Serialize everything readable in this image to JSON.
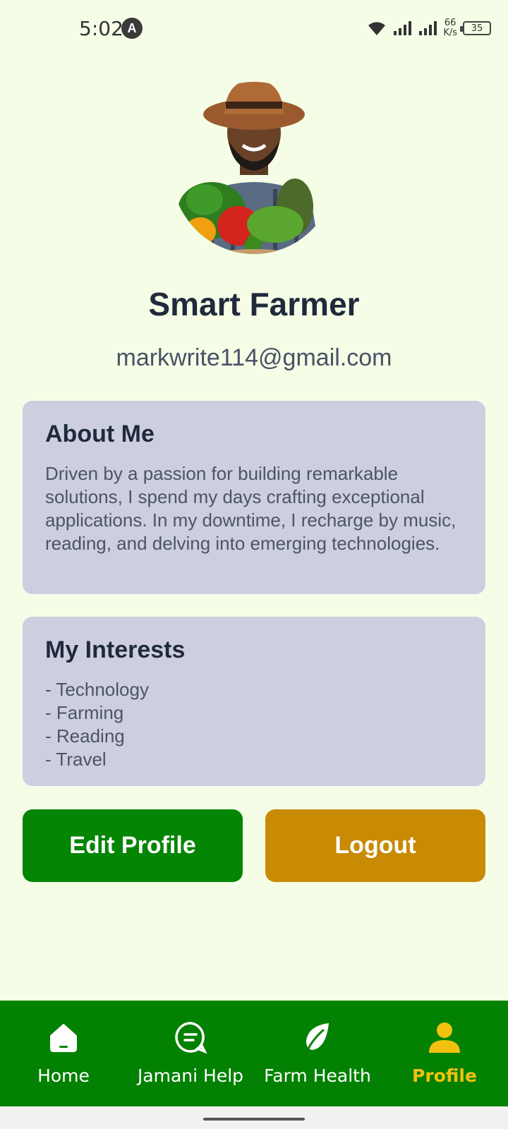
{
  "status": {
    "time": "5:02",
    "badge": "A",
    "net_speed_value": "66",
    "net_speed_unit": "K/s",
    "battery": "35"
  },
  "profile": {
    "name": "Smart Farmer",
    "email": "markwrite114@gmail.com"
  },
  "about": {
    "title": "About Me",
    "text": "Driven by a passion for building remarkable solutions, I spend my days crafting exceptional applications. In my downtime, I recharge by music, reading, and delving into emerging technologies."
  },
  "interests": {
    "title": "My Interests",
    "items": [
      "- Technology",
      "- Farming",
      "- Reading",
      "- Travel"
    ]
  },
  "actions": {
    "edit_label": "Edit Profile",
    "logout_label": "Logout"
  },
  "nav": {
    "items": [
      {
        "label": "Home",
        "icon": "home-icon"
      },
      {
        "label": "Jamani Help",
        "icon": "chat-icon"
      },
      {
        "label": "Farm Health",
        "icon": "leaf-icon"
      },
      {
        "label": "Profile",
        "icon": "user-icon"
      }
    ],
    "active": "Profile"
  },
  "colors": {
    "background": "#f5fde6",
    "card": "#cdcfe1",
    "primary_green": "#048504",
    "logout_gold": "#c98a04",
    "active_nav": "#f2c10f"
  }
}
